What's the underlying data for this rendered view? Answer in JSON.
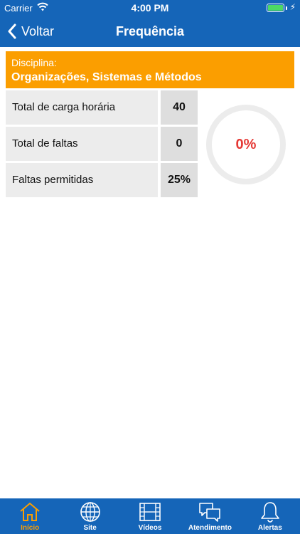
{
  "status": {
    "carrier": "Carrier",
    "time": "4:00 PM"
  },
  "nav": {
    "back_label": "Voltar",
    "title": "Frequência"
  },
  "discipline": {
    "label": "Disciplina:",
    "name": "Organizações, Sistemas e Métodos"
  },
  "stats": [
    {
      "label": "Total de carga horária",
      "value": "40"
    },
    {
      "label": "Total de faltas",
      "value": "0"
    },
    {
      "label": "Faltas permitidas",
      "value": "25%"
    }
  ],
  "gauge": {
    "percent_text": "0%",
    "fraction": 0
  },
  "tabs": [
    {
      "label": "Início",
      "icon": "home-icon"
    },
    {
      "label": "Site",
      "icon": "globe-icon"
    },
    {
      "label": "Vídeos",
      "icon": "film-icon"
    },
    {
      "label": "Atendimento",
      "icon": "chat-icon"
    },
    {
      "label": "Alertas",
      "icon": "bell-icon"
    }
  ],
  "colors": {
    "primary": "#1565b8",
    "accent": "#fb9e00",
    "gauge_text": "#e53935"
  }
}
